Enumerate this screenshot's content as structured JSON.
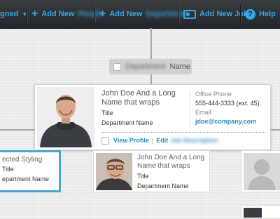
{
  "toolbar": {
    "assigned_label": "gned",
    "add_people_prefix": "Add New",
    "add_people_blurred": "People",
    "add_dept_prefix": "Add New",
    "add_dept_blurred": "Department",
    "add_job_label": "Add New Job",
    "help_label": "Help",
    "accent": "#35a8e8"
  },
  "department": {
    "blurred": "Department",
    "label": "Name"
  },
  "selected_card": {
    "name": "John Doe And a Long  Name that wraps",
    "title": "Title",
    "department": "Department Name",
    "office_phone_label": "Office Phone",
    "office_phone": "555-444-3333 (ext. 45)",
    "email_label": "Email",
    "email": "jdoe@company.com",
    "view_profile": "View Profile",
    "separator": "|",
    "edit_prefix": "Edit",
    "edit_blurred": "Job Description"
  },
  "left_card": {
    "name": "ected Styling",
    "title": "Title",
    "department": "epartment Name",
    "accent": "#4ea6cf"
  },
  "middle_card": {
    "name": "John Doe And a Long Name that wraps",
    "title": "Title",
    "department": "Department Name"
  }
}
